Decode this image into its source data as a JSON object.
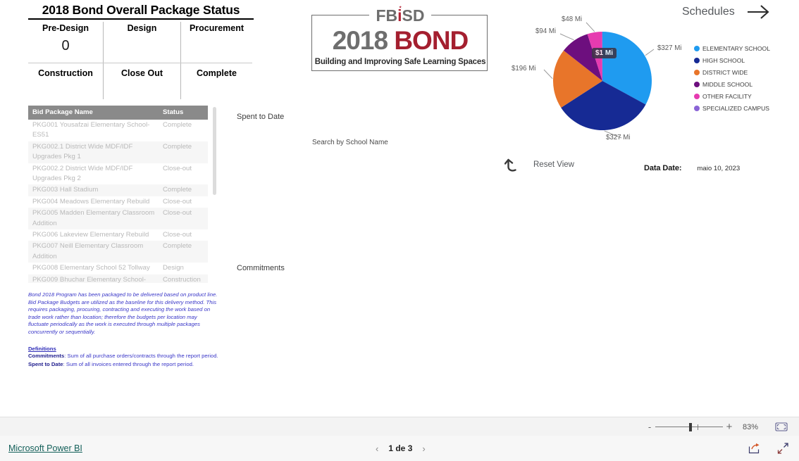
{
  "status_card": {
    "title": "2018 Bond Overall Package Status",
    "cells": [
      {
        "label": "Pre-Design",
        "value": "0"
      },
      {
        "label": "Design",
        "value": ""
      },
      {
        "label": "Procurement",
        "value": ""
      },
      {
        "label": "Construction",
        "value": ""
      },
      {
        "label": "Close Out",
        "value": ""
      },
      {
        "label": "Complete",
        "value": ""
      }
    ]
  },
  "table": {
    "columns": [
      "Bid Package Name",
      "Status"
    ],
    "rows": [
      {
        "name": "PKG001 Yousafzai Elementary School-ES51",
        "status": "Complete"
      },
      {
        "name": "PKG002.1 District Wide MDF/IDF Upgrades Pkg 1",
        "status": "Complete"
      },
      {
        "name": "PKG002.2 District Wide MDF/IDF Upgrades Pkg 2",
        "status": "Close-out"
      },
      {
        "name": "PKG003 Hall Stadium",
        "status": "Complete"
      },
      {
        "name": "PKG004 Meadows Elementary Rebuild",
        "status": "Close-out"
      },
      {
        "name": "PKG005 Madden Elementary Classroom Addition",
        "status": "Close-out"
      },
      {
        "name": "PKG006 Lakeview Elementary Rebuild",
        "status": "Close-out"
      },
      {
        "name": "PKG007 Neill Elementary Classroom Addition",
        "status": "Complete"
      },
      {
        "name": "PKG008 Elementary School 52 Tollway",
        "status": "Design"
      },
      {
        "name": "PKG009 Bhuchar Elementary School-",
        "status": "Construction"
      }
    ]
  },
  "notes": {
    "paragraph": "Bond 2018 Program has been packaged to be delivered based on product line.  Bid Package Budgets are utilized as the baseline for this delivery method. This requires packaging, procuring, contracting and executing the work based on trade work rather than location; therefore the budgets per location may fluctuate periodically as the work is executed through multiple packages concurrently or sequentially.",
    "definitions_heading": "Definitions",
    "definitions": [
      {
        "term": "Commitments",
        "text": ": Sum of all purchase orders/contracts through the report period."
      },
      {
        "term": "Spent to Date",
        "text": ": Sum of all invoices entered through the report period."
      }
    ]
  },
  "mid": {
    "spent_to_date_label": "Spent to Date",
    "commitments_label": "Commitments",
    "search_placeholder": "Search by School Name"
  },
  "logo": {
    "fbisd_pre": "FB",
    "fbisd_i": "i",
    "fbisd_post": "SD",
    "year": "2018",
    "word": "BOND",
    "tagline": "Building and Improving Safe Learning Spaces"
  },
  "header": {
    "schedules_label": "Schedules"
  },
  "reset": {
    "label": "Reset View"
  },
  "data_date": {
    "label": "Data Date:",
    "value": "maio 10, 2023"
  },
  "chart_data": {
    "type": "pie",
    "title": "",
    "unit": "Millions USD",
    "legend_position": "right",
    "categories": [
      "ELEMENTARY SCHOOL",
      "HIGH SCHOOL",
      "DISTRICT WIDE",
      "MIDDLE SCHOOL",
      "OTHER FACILITY",
      "SPECIALIZED CAMPUS"
    ],
    "values": [
      327,
      327,
      196,
      94,
      48,
      1
    ],
    "labels": [
      "$327 Mi",
      "$327 Mi",
      "$196 Mi",
      "$94 Mi",
      "$48 Mi",
      "$1 Mi"
    ],
    "colors": [
      "#1f9bf0",
      "#162a94",
      "#e8752a",
      "#6d0f7e",
      "#e63bb0",
      "#8a64d6"
    ],
    "highlighted_slice": "SPECIALIZED CAMPUS",
    "tooltip": "$1 Mi"
  },
  "zoom_bar": {
    "minus": "-",
    "plus": "+",
    "percent": "83%"
  },
  "bottom": {
    "powerbi_label": "Microsoft Power BI",
    "page_text": "1 de 3",
    "prev": "‹",
    "next": "›"
  }
}
